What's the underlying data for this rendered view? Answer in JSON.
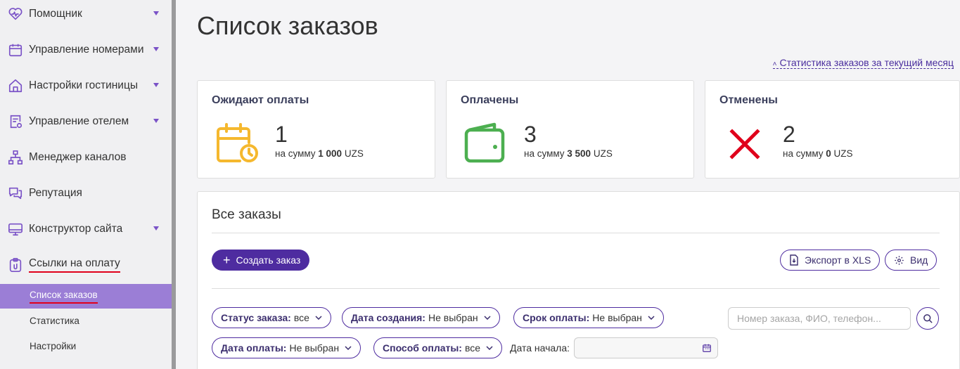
{
  "sidebar": {
    "items": [
      {
        "label": "Помощник",
        "icon": "heart-pulse-icon",
        "has_caret": true
      },
      {
        "label": "Управление номерами",
        "icon": "calendar-icon",
        "has_caret": true
      },
      {
        "label": "Настройки гостиницы",
        "icon": "home-icon",
        "has_caret": true
      },
      {
        "label": "Управление отелем",
        "icon": "settings-doc-icon",
        "has_caret": true
      },
      {
        "label": "Менеджер каналов",
        "icon": "sitemap-icon",
        "has_caret": false
      },
      {
        "label": "Репутация",
        "icon": "chat-bubbles-icon",
        "has_caret": false
      },
      {
        "label": "Конструктор сайта",
        "icon": "monitor-icon",
        "has_caret": true
      },
      {
        "label": "Ссылки на оплату",
        "icon": "clipboard-icon",
        "has_caret": false
      }
    ],
    "subitems": [
      {
        "label": "Список заказов",
        "active": true
      },
      {
        "label": "Статистика",
        "active": false
      },
      {
        "label": "Настройки",
        "active": false
      }
    ]
  },
  "main": {
    "title": "Список заказов",
    "stats_link": "Статистика заказов за текущий месяц",
    "cards": [
      {
        "title": "Ожидают оплаты",
        "count": "1",
        "sum_prefix": "на сумму ",
        "sum_amount": "1 000",
        "currency": " UZS",
        "icon": "calendar-clock-icon",
        "color": "#f5b82e"
      },
      {
        "title": "Оплачены",
        "count": "3",
        "sum_prefix": "на сумму ",
        "sum_amount": "3 500",
        "currency": " UZS",
        "icon": "wallet-icon",
        "color": "#4caf50"
      },
      {
        "title": "Отменены",
        "count": "2",
        "sum_prefix": "на сумму ",
        "sum_amount": "0",
        "currency": " UZS",
        "icon": "cross-icon",
        "color": "#e0001b"
      }
    ],
    "orders": {
      "title": "Все заказы",
      "create_button": "Создать заказ",
      "export_button": "Экспорт в XLS",
      "view_button": "Вид",
      "filters": [
        {
          "name": "Статус заказа:",
          "value": "все"
        },
        {
          "name": "Дата создания:",
          "value": "Не выбран"
        },
        {
          "name": "Срок оплаты:",
          "value": "Не выбран"
        },
        {
          "name": "Дата оплаты:",
          "value": "Не выбран"
        },
        {
          "name": "Способ оплаты:",
          "value": "все"
        }
      ],
      "search_placeholder": "Номер заказа, ФИО, телефон...",
      "search_value": "",
      "date_start_label": "Дата начала:",
      "date_start_value": ""
    }
  },
  "colors": {
    "accent": "#4e2ca0",
    "active_subitem": "#9b7ed6",
    "highlight_underline": "#e0001b"
  }
}
